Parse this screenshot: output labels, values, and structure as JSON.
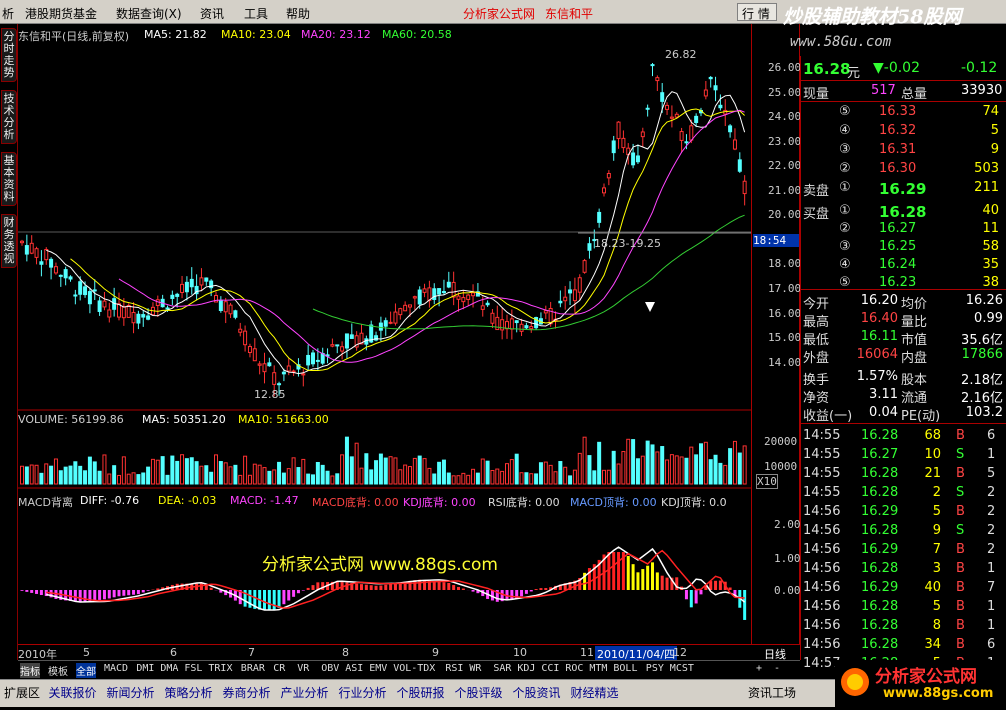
{
  "menu": {
    "items": [
      "析",
      "港股期货基金",
      "数据查询(X)",
      "资讯",
      "工具",
      "帮助"
    ],
    "title": "分析家公式网",
    "stock_title": "东信和平",
    "page_button": "行 情",
    "brand": "炒股辅助教材58股网",
    "domain": "www.58Gu.com"
  },
  "lefttabs": [
    "分时走势",
    "技术分析",
    "基本资料",
    "财务透视"
  ],
  "main_header": {
    "name": "东信和平(日线,前复权)",
    "ma5": "MA5: 21.82",
    "ma10": "MA10: 23.04",
    "ma20": "MA20: 23.12",
    "ma60": "MA60: 20.58"
  },
  "annotations": {
    "high": "26.82",
    "low": "12.85",
    "range": "18.23-19.25",
    "cursor_price": "18:54"
  },
  "y_axis": [
    "26.00",
    "25.00",
    "24.00",
    "23.00",
    "22.00",
    "21.00",
    "20.00",
    "18.00",
    "17.00",
    "16.00",
    "15.00",
    "14.00"
  ],
  "volume_header": {
    "vol": "VOLUME: 56199.86",
    "ma5": "MA5: 50351.20",
    "ma10": "MA10: 51663.00"
  },
  "volume_axis": [
    "20000",
    "10000",
    "X10"
  ],
  "macd_header": {
    "name": "MACD背离",
    "diff": "DIFF: -0.76",
    "dea": "DEA: -0.03",
    "macd": "MACD: -1.47",
    "macd_bottom": "MACD底背: 0.00",
    "kdj_bottom": "KDJ底背: 0.00",
    "rsi_bottom": "RSI底背: 0.00",
    "macd_top": "MACD顶背: 0.00",
    "kdj_top": "KDJ顶背: 0.0"
  },
  "macd_axis": [
    "2.00",
    "1.00",
    "0.00"
  ],
  "watermark": "分析家公式网 www.88gs.com",
  "time_axis": {
    "labels": [
      "2010年",
      "5",
      "6",
      "7",
      "8",
      "9",
      "10",
      "11",
      "12"
    ],
    "cursor_date": "2010/11/04/四",
    "period": "日线"
  },
  "index_tabs": [
    "指标",
    "模板",
    "全部",
    "MACD",
    "DMI",
    "DMA",
    "FSL",
    "TRIX",
    "BRAR",
    "CR",
    "VR",
    "OBV",
    "ASI",
    "EMV",
    "VOL-TDX",
    "RSI",
    "WR",
    "SAR",
    "KDJ",
    "CCI",
    "ROC",
    "MTM",
    "BOLL",
    "PSY",
    "MCST"
  ],
  "index_controls": [
    "+",
    "-"
  ],
  "bottom_tabs": [
    "扩展区",
    "关联报价",
    "新闻分析",
    "策略分析",
    "券商分析",
    "产业分析",
    "行业分析",
    "个股研报",
    "个股评级",
    "个股资讯",
    "财经精选"
  ],
  "bottom_right": "资讯工场",
  "quote": {
    "price": "16.28",
    "unit": "元",
    "change": "▼-0.02",
    "change2": "-0.12",
    "now_vol_label": "现量",
    "now_vol": "517",
    "total_label": "总量",
    "total": "33930",
    "sells": [
      {
        "n": "⑤",
        "p": "16.33",
        "v": "74"
      },
      {
        "n": "④",
        "p": "16.32",
        "v": "5"
      },
      {
        "n": "③",
        "p": "16.31",
        "v": "9"
      },
      {
        "n": "②",
        "p": "16.30",
        "v": "503"
      },
      {
        "n": "①",
        "p": "16.29",
        "v": "211",
        "label": "卖盘"
      }
    ],
    "buys": [
      {
        "n": "①",
        "p": "16.28",
        "v": "40",
        "label": "买盘"
      },
      {
        "n": "②",
        "p": "16.27",
        "v": "11"
      },
      {
        "n": "③",
        "p": "16.25",
        "v": "58"
      },
      {
        "n": "④",
        "p": "16.24",
        "v": "35"
      },
      {
        "n": "⑤",
        "p": "16.23",
        "v": "38"
      }
    ],
    "stats": [
      [
        "今开",
        "16.20",
        "均价",
        "16.26"
      ],
      [
        "最高",
        "16.40",
        "量比",
        "0.99"
      ],
      [
        "最低",
        "16.11",
        "市值",
        "35.6亿"
      ],
      [
        "外盘",
        "16064",
        "内盘",
        "17866"
      ],
      [
        "换手",
        "1.57%",
        "股本",
        "2.18亿"
      ],
      [
        "净资",
        "3.11",
        "流通",
        "2.16亿"
      ],
      [
        "收益(一)",
        "0.04",
        "PE(动)",
        "103.2"
      ]
    ],
    "ticks": [
      [
        "14:55",
        "16.28",
        "68",
        "B",
        "6"
      ],
      [
        "14:55",
        "16.27",
        "10",
        "S",
        "1"
      ],
      [
        "14:55",
        "16.28",
        "21",
        "B",
        "5"
      ],
      [
        "14:55",
        "16.28",
        "2",
        "S",
        "2"
      ],
      [
        "14:56",
        "16.29",
        "5",
        "B",
        "2"
      ],
      [
        "14:56",
        "16.28",
        "9",
        "S",
        "2"
      ],
      [
        "14:56",
        "16.29",
        "7",
        "B",
        "2"
      ],
      [
        "14:56",
        "16.28",
        "3",
        "B",
        "1"
      ],
      [
        "14:56",
        "16.29",
        "40",
        "B",
        "7"
      ],
      [
        "14:56",
        "16.28",
        "5",
        "B",
        "1"
      ],
      [
        "14:56",
        "16.28",
        "8",
        "B",
        "1"
      ],
      [
        "14:56",
        "16.28",
        "34",
        "B",
        "6"
      ],
      [
        "14:57",
        "16.28",
        "5",
        "B",
        "1"
      ]
    ]
  },
  "logo": {
    "cn": "分析家公式网",
    "url": "www.88gs.com"
  }
}
